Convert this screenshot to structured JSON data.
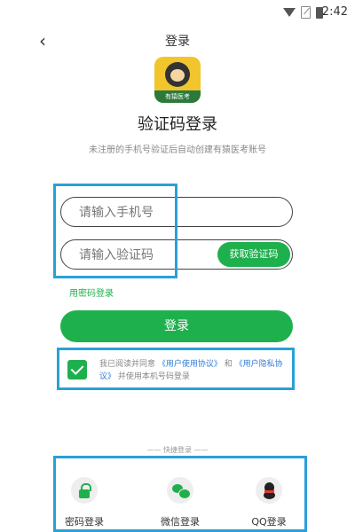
{
  "status": {
    "time": "2:42"
  },
  "header": {
    "back_icon": "chevron-left-icon",
    "title": "登录"
  },
  "logo": {
    "text": "有猿医考"
  },
  "main": {
    "heading": "验证码登录",
    "subtitle": "未注册的手机号验证后自动创建有猿医考账号",
    "phone_placeholder": "请输入手机号",
    "code_placeholder": "请输入验证码",
    "get_code_label": "获取验证码",
    "password_login_link": "用密码登录",
    "login_button": "登录"
  },
  "agreement": {
    "checked": true,
    "prefix": "我已阅读并同意",
    "link1": "《用户使用协议》",
    "and": "和",
    "link2": "《用户隐私协议》",
    "suffix": "并使用本机号码登录"
  },
  "quick_login": {
    "title": "—— 快捷登录 ——",
    "items": [
      {
        "label": "密码登录",
        "icon": "lock-icon"
      },
      {
        "label": "微信登录",
        "icon": "wechat-icon"
      },
      {
        "label": "QQ登录",
        "icon": "qq-icon"
      }
    ]
  },
  "colors": {
    "accent": "#1fb04e",
    "link": "#2f7bd9",
    "highlight": "#2aa0d8"
  }
}
